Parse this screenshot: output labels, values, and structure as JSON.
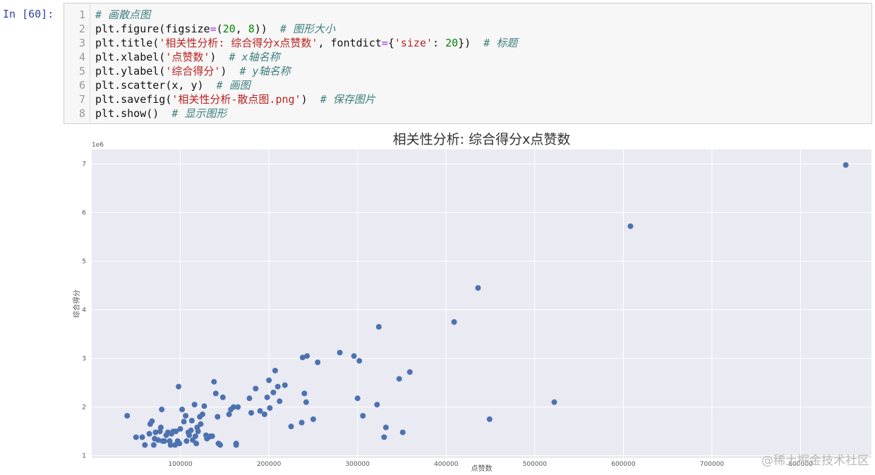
{
  "prompt": "In [60]:",
  "code_lines": [
    {
      "n": "1",
      "parts": [
        {
          "t": "c",
          "v": "# 画散点图"
        }
      ]
    },
    {
      "n": "2",
      "parts": [
        {
          "t": "k",
          "v": "plt.figure(figsize"
        },
        {
          "t": "o",
          "v": "="
        },
        {
          "t": "k",
          "v": "("
        },
        {
          "t": "n",
          "v": "20"
        },
        {
          "t": "k",
          "v": ", "
        },
        {
          "t": "n",
          "v": "8"
        },
        {
          "t": "k",
          "v": "))  "
        },
        {
          "t": "c",
          "v": "# 图形大小"
        }
      ]
    },
    {
      "n": "3",
      "parts": [
        {
          "t": "k",
          "v": "plt.title("
        },
        {
          "t": "s",
          "v": "'相关性分析: 综合得分x点赞数'"
        },
        {
          "t": "k",
          "v": ", fontdict"
        },
        {
          "t": "o",
          "v": "="
        },
        {
          "t": "k",
          "v": "{"
        },
        {
          "t": "s",
          "v": "'size'"
        },
        {
          "t": "k",
          "v": ": "
        },
        {
          "t": "n",
          "v": "20"
        },
        {
          "t": "k",
          "v": "})  "
        },
        {
          "t": "c",
          "v": "# 标题"
        }
      ]
    },
    {
      "n": "4",
      "parts": [
        {
          "t": "k",
          "v": "plt.xlabel("
        },
        {
          "t": "s",
          "v": "'点赞数'"
        },
        {
          "t": "k",
          "v": ")  "
        },
        {
          "t": "c",
          "v": "# x轴名称"
        }
      ]
    },
    {
      "n": "5",
      "parts": [
        {
          "t": "k",
          "v": "plt.ylabel("
        },
        {
          "t": "s",
          "v": "'综合得分'"
        },
        {
          "t": "k",
          "v": ")  "
        },
        {
          "t": "c",
          "v": "# y轴名称"
        }
      ]
    },
    {
      "n": "6",
      "parts": [
        {
          "t": "k",
          "v": "plt.scatter(x, y)  "
        },
        {
          "t": "c",
          "v": "# 画图"
        }
      ]
    },
    {
      "n": "7",
      "parts": [
        {
          "t": "k",
          "v": "plt.savefig("
        },
        {
          "t": "s",
          "v": "'相关性分析-散点图.png'"
        },
        {
          "t": "k",
          "v": ")  "
        },
        {
          "t": "c",
          "v": "# 保存图片"
        }
      ]
    },
    {
      "n": "8",
      "parts": [
        {
          "t": "k",
          "v": "plt.show()  "
        },
        {
          "t": "c",
          "v": "# 显示图形"
        }
      ]
    }
  ],
  "watermark": "@稀土掘金技术社区",
  "chart_data": {
    "type": "scatter",
    "title": "相关性分析: 综合得分x点赞数",
    "xlabel": "点赞数",
    "ylabel": "综合得分",
    "y_offset_label": "1e6",
    "xlim": [
      0,
      880000
    ],
    "ylim": [
      0.95,
      7.3
    ],
    "xticks": [
      100000,
      200000,
      300000,
      400000,
      500000,
      600000,
      700000,
      800000
    ],
    "xtick_labels": [
      "100000",
      "200000",
      "300000",
      "400000",
      "500000",
      "600000",
      "700000",
      "800000"
    ],
    "yticks": [
      1,
      2,
      3,
      4,
      5,
      6,
      7
    ],
    "ytick_labels": [
      "1",
      "2",
      "3",
      "4",
      "5",
      "6",
      "7"
    ],
    "grid": true,
    "point_color": "#4c72b0",
    "background": "#eaeaf2",
    "x": [
      40000,
      50000,
      57000,
      60000,
      65000,
      66000,
      68000,
      70000,
      71000,
      72000,
      75000,
      77000,
      78000,
      79000,
      80000,
      82000,
      84000,
      86000,
      88000,
      89000,
      90000,
      92000,
      94000,
      95000,
      97000,
      98000,
      99000,
      100000,
      102000,
      104000,
      106000,
      107000,
      109000,
      110000,
      112000,
      113000,
      114000,
      116000,
      117000,
      118000,
      119000,
      120000,
      122000,
      123000,
      125000,
      127000,
      129000,
      130000,
      132000,
      134000,
      136000,
      138000,
      140000,
      142000,
      143000,
      145000,
      148000,
      155000,
      157000,
      160000,
      163000,
      163000,
      165000,
      178000,
      180000,
      185000,
      190000,
      195000,
      198000,
      200000,
      201000,
      205000,
      207000,
      210000,
      212000,
      218000,
      225000,
      237000,
      238000,
      240000,
      242000,
      243000,
      250000,
      255000,
      280000,
      296000,
      300000,
      302000,
      306000,
      322000,
      324000,
      330000,
      332000,
      347000,
      351000,
      359000,
      409000,
      436000,
      449000,
      522000,
      608000,
      851000
    ],
    "y": [
      1.82,
      1.38,
      1.38,
      1.22,
      1.45,
      1.65,
      1.71,
      1.22,
      1.35,
      1.48,
      1.32,
      1.5,
      1.58,
      1.95,
      1.3,
      1.3,
      1.42,
      1.48,
      1.3,
      1.22,
      1.45,
      1.5,
      1.22,
      1.5,
      1.3,
      2.42,
      1.25,
      1.55,
      1.95,
      1.7,
      1.82,
      1.3,
      1.48,
      1.42,
      1.52,
      1.72,
      1.32,
      2.05,
      1.4,
      1.25,
      1.58,
      1.5,
      1.8,
      1.65,
      1.85,
      2.02,
      1.42,
      1.35,
      1.38,
      1.4,
      1.4,
      2.52,
      2.28,
      1.8,
      1.25,
      1.22,
      2.2,
      1.85,
      1.95,
      2.0,
      1.25,
      1.22,
      2.0,
      2.18,
      1.88,
      2.38,
      1.92,
      1.85,
      2.2,
      2.55,
      1.98,
      2.3,
      2.75,
      2.42,
      2.12,
      2.45,
      1.6,
      1.68,
      3.02,
      2.28,
      2.1,
      3.05,
      1.75,
      2.92,
      3.12,
      3.05,
      2.18,
      2.95,
      1.82,
      2.05,
      3.65,
      1.38,
      1.58,
      2.58,
      1.48,
      2.72,
      3.75,
      4.45,
      1.75,
      2.1,
      5.72,
      6.98
    ]
  }
}
